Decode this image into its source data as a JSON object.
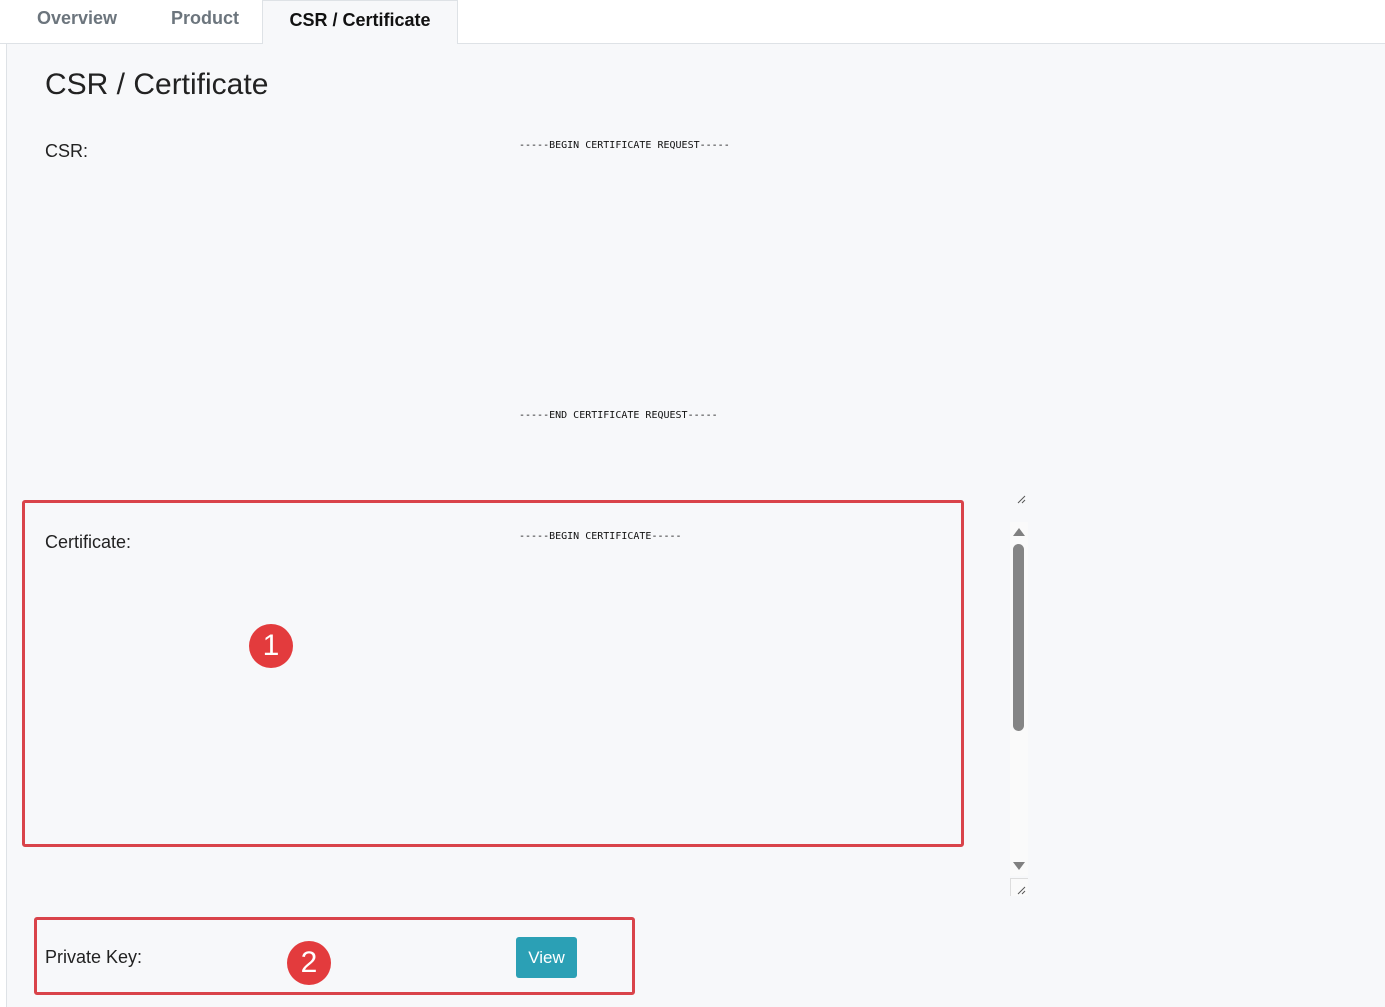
{
  "tabs": [
    {
      "label": "Overview",
      "active": false
    },
    {
      "label": "Product",
      "active": false
    },
    {
      "label": "CSR / Certificate",
      "active": true
    }
  ],
  "page": {
    "title": "CSR / Certificate"
  },
  "csr": {
    "label": "CSR:",
    "begin_line": "-----BEGIN CERTIFICATE REQUEST-----",
    "end_line": "-----END CERTIFICATE REQUEST-----"
  },
  "certificate": {
    "label": "Certificate:",
    "begin_line": "-----BEGIN CERTIFICATE-----"
  },
  "private_key": {
    "label": "Private Key:",
    "view_button": "View"
  },
  "annotations": {
    "marker1": "1",
    "marker2": "2",
    "highlight_color": "#d9434a",
    "marker_color": "#e33b3d"
  },
  "colors": {
    "accent_button": "#2ba0b5",
    "panel_bg": "#f7f8fa"
  }
}
